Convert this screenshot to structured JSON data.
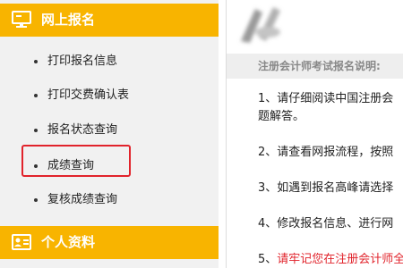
{
  "sidebar": {
    "section_online": {
      "title": "网上报名",
      "icon": "monitor-icon"
    },
    "items": [
      {
        "label": "打印报名信息"
      },
      {
        "label": "打印交费确认表"
      },
      {
        "label": "报名状态查询"
      },
      {
        "label": "成绩查询",
        "highlighted": true
      },
      {
        "label": "复核成绩查询"
      }
    ],
    "section_profile": {
      "title": "个人资料",
      "icon": "id-card-icon"
    },
    "accent_color": "#f8b400",
    "highlight_color": "#e1232b"
  },
  "content": {
    "notice_title": "注册会计师考试报名说明:",
    "paragraphs": [
      {
        "line1": "1、请仔细阅读中国注册会",
        "line2": "题解答。"
      },
      {
        "line1": "2、请查看网报流程，按照"
      },
      {
        "line1": "3、如遇到报名高峰请选择"
      },
      {
        "line1": "4、修改报名信息、进行网"
      },
      {
        "num": "5、",
        "line1": "请牢记您在注册会计师全"
      }
    ]
  }
}
